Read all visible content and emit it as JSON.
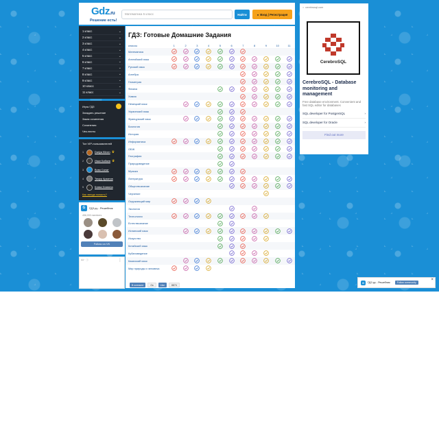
{
  "header": {
    "logo_main": "Gdz",
    "logo_tld": ".ru",
    "slogan": "Решение есть!",
    "search_placeholder": "Математика 5 класс",
    "search_button": "Найти",
    "login_button": "Вход | Регистрация"
  },
  "sidebar": {
    "grades": [
      "1 класс",
      "2 класс",
      "3 класс",
      "4 класс",
      "5 класс",
      "6 класс",
      "7 класс",
      "8 класс",
      "9 класс",
      "10 класс",
      "11 класс"
    ],
    "extras": [
      "Игры ГДЗ",
      "Загадать решение",
      "Заказ сочинения",
      "Сочинения",
      "Чек-листы"
    ],
    "vip_title": "Топ VIP-пользователей",
    "vip_users": [
      {
        "num": "1",
        "name": "Dariya Klinen"
      },
      {
        "num": "2",
        "name": "Иван Бабаев"
      },
      {
        "num": "3",
        "name": "Вова Салат"
      },
      {
        "num": "4",
        "name": "Тимур Арзанов"
      },
      {
        "num": "5",
        "name": "Клава Клавина"
      }
    ],
    "vip_link": "Как звезда попасть?",
    "vk_group": "ГДЗ.ру - Решебник",
    "vk_members": "456,000 members",
    "vk_follow": "Follow on VK",
    "ad_label": "Ad · ⓘ"
  },
  "main": {
    "title": "ГДЗ: Готовые Домашние Задания",
    "classes_label": "классы",
    "grade_numbers": [
      "1",
      "2",
      "3",
      "4",
      "5",
      "6",
      "7",
      "8",
      "9",
      "10",
      "11"
    ],
    "subjects": [
      {
        "name": "Математика",
        "grades": [
          1,
          1,
          1,
          1,
          1,
          1,
          1,
          0,
          0,
          0,
          0
        ]
      },
      {
        "name": "Английский язык",
        "grades": [
          1,
          1,
          1,
          1,
          1,
          1,
          1,
          1,
          1,
          1,
          1
        ]
      },
      {
        "name": "Русский язык",
        "grades": [
          1,
          1,
          1,
          1,
          1,
          1,
          1,
          1,
          1,
          1,
          1
        ]
      },
      {
        "name": "Алгебра",
        "grades": [
          0,
          0,
          0,
          0,
          0,
          0,
          1,
          1,
          1,
          1,
          1
        ]
      },
      {
        "name": "Геометрия",
        "grades": [
          0,
          0,
          0,
          0,
          0,
          0,
          1,
          1,
          1,
          1,
          1
        ]
      },
      {
        "name": "Физика",
        "grades": [
          0,
          0,
          0,
          0,
          1,
          1,
          1,
          1,
          1,
          1,
          1
        ]
      },
      {
        "name": "Химия",
        "grades": [
          0,
          0,
          0,
          0,
          0,
          0,
          1,
          1,
          1,
          1,
          1
        ]
      },
      {
        "name": "Немецкий язык",
        "grades": [
          0,
          1,
          1,
          1,
          1,
          1,
          1,
          1,
          1,
          1,
          1
        ]
      },
      {
        "name": "Украинский язык",
        "grades": [
          0,
          0,
          0,
          0,
          1,
          1,
          1,
          0,
          0,
          0,
          0
        ]
      },
      {
        "name": "Французский язык",
        "grades": [
          0,
          1,
          1,
          1,
          1,
          1,
          1,
          1,
          1,
          1,
          1
        ]
      },
      {
        "name": "Биология",
        "grades": [
          0,
          0,
          0,
          0,
          1,
          1,
          1,
          1,
          1,
          1,
          1
        ]
      },
      {
        "name": "История",
        "grades": [
          0,
          0,
          0,
          0,
          1,
          1,
          1,
          1,
          1,
          1,
          1
        ]
      },
      {
        "name": "Информатика",
        "grades": [
          1,
          1,
          1,
          1,
          1,
          1,
          1,
          1,
          1,
          1,
          1
        ]
      },
      {
        "name": "ОБЖ",
        "grades": [
          0,
          0,
          0,
          0,
          1,
          1,
          1,
          1,
          1,
          1,
          1
        ]
      },
      {
        "name": "География",
        "grades": [
          0,
          0,
          0,
          0,
          1,
          1,
          1,
          1,
          1,
          1,
          1
        ]
      },
      {
        "name": "Природоведение",
        "grades": [
          0,
          0,
          0,
          0,
          1,
          1,
          0,
          0,
          0,
          0,
          0
        ]
      },
      {
        "name": "Музыка",
        "grades": [
          1,
          1,
          1,
          1,
          1,
          1,
          1,
          0,
          0,
          0,
          0
        ]
      },
      {
        "name": "Литература",
        "grades": [
          1,
          1,
          1,
          1,
          1,
          1,
          1,
          1,
          1,
          1,
          1
        ]
      },
      {
        "name": "Обществознание",
        "grades": [
          0,
          0,
          0,
          0,
          0,
          1,
          1,
          1,
          1,
          1,
          1
        ]
      },
      {
        "name": "Черчение",
        "grades": [
          0,
          0,
          0,
          0,
          0,
          0,
          0,
          0,
          1,
          0,
          0
        ]
      },
      {
        "name": "Окружающий мир",
        "grades": [
          1,
          1,
          1,
          1,
          0,
          0,
          0,
          0,
          0,
          0,
          0
        ]
      },
      {
        "name": "Экология",
        "grades": [
          0,
          0,
          0,
          0,
          0,
          1,
          0,
          1,
          0,
          0,
          0
        ]
      },
      {
        "name": "Технология",
        "grades": [
          1,
          1,
          1,
          1,
          1,
          1,
          1,
          1,
          1,
          0,
          0
        ]
      },
      {
        "name": "Естествознание",
        "grades": [
          0,
          0,
          0,
          0,
          1,
          1,
          0,
          0,
          0,
          0,
          0
        ]
      },
      {
        "name": "Испанский язык",
        "grades": [
          0,
          1,
          1,
          1,
          1,
          1,
          1,
          1,
          1,
          1,
          1
        ]
      },
      {
        "name": "Искусство",
        "grades": [
          0,
          0,
          0,
          0,
          1,
          1,
          1,
          1,
          1,
          0,
          0
        ]
      },
      {
        "name": "Китайский язык",
        "grades": [
          0,
          0,
          0,
          0,
          1,
          1,
          1,
          0,
          0,
          0,
          0
        ]
      },
      {
        "name": "Кубановедение",
        "grades": [
          0,
          0,
          0,
          0,
          0,
          1,
          1,
          1,
          1,
          0,
          0
        ]
      },
      {
        "name": "Казахский язык",
        "grades": [
          0,
          1,
          1,
          1,
          1,
          1,
          1,
          1,
          1,
          1,
          1
        ]
      },
      {
        "name": "Мир природы и человека",
        "grades": [
          1,
          1,
          1,
          1,
          0,
          0,
          0,
          0,
          0,
          0,
          0
        ]
      }
    ],
    "grade_colors": [
      "#e74c3c",
      "#c2509e",
      "#2e6fd1",
      "#d4a017",
      "#43a047",
      "#6a5acd",
      "#e74c3c",
      "#c2509e",
      "#d4a017",
      "#43a047",
      "#6a5acd"
    ],
    "share_vk": "В контакте",
    "share_ok": "Ок",
    "share_like": "Like",
    "share_count": "8874"
  },
  "ad": {
    "domain": "cerebrosql.com",
    "brand": "CerebroSQL",
    "title": "CerebroSQL - Database monitoring and management",
    "desc": "Free database environment. Convenient and fast SQL editor for databases",
    "links": [
      "SQL developer for PostgreSQL",
      "SQL developer for Oracle"
    ],
    "find_more": "Find out more"
  },
  "vk_widget": {
    "group": "ГДЗ.ру - Решебник",
    "follow": "Follow community"
  }
}
